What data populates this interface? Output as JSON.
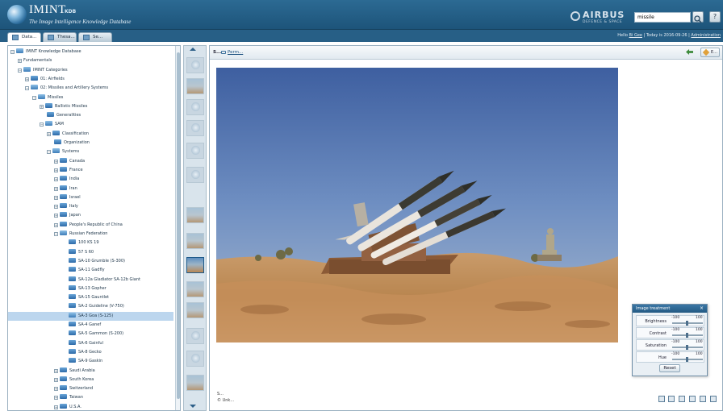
{
  "header": {
    "app_name": "IMINT",
    "app_name_suffix": "KDB",
    "subtitle": "The Image Intelligence Knowledge Database",
    "brand_name": "AIRBUS",
    "brand_sub": "DEFENCE & SPACE",
    "search_value": "missile",
    "help_label": "?"
  },
  "tabs": [
    {
      "label": "Data..."
    },
    {
      "label": "Thesa..."
    },
    {
      "label": "Se..."
    }
  ],
  "user_info": {
    "prefix": "Hello",
    "user": "Bi Gee",
    "today": "| Today is 2016-09-26 |",
    "admin": "Administration"
  },
  "tree": [
    {
      "label": "IMINT Knowledge Database",
      "level": 0,
      "expander": "−",
      "folder": "open"
    },
    {
      "label": "Fundamentals",
      "level": 1,
      "expander": "+",
      "folder": "none"
    },
    {
      "label": "IMINT Categories",
      "level": 1,
      "expander": "−",
      "folder": "open"
    },
    {
      "label": "01: Airfields",
      "level": 2,
      "expander": "+",
      "folder": "closed"
    },
    {
      "label": "02: Missiles and Artillery Systems",
      "level": 2,
      "expander": "−",
      "folder": "open"
    },
    {
      "label": "Missiles",
      "level": 3,
      "expander": "−",
      "folder": "open"
    },
    {
      "label": "Ballistic Missiles",
      "level": 4,
      "expander": "+",
      "folder": "closed"
    },
    {
      "label": "Generalities",
      "level": 4,
      "expander": "",
      "folder": "closed"
    },
    {
      "label": "SAM",
      "level": 4,
      "expander": "−",
      "folder": "open"
    },
    {
      "label": "Classification",
      "level": 5,
      "expander": "+",
      "folder": "closed"
    },
    {
      "label": "Organization",
      "level": 5,
      "expander": "",
      "folder": "closed"
    },
    {
      "label": "Systems",
      "level": 5,
      "expander": "−",
      "folder": "open"
    },
    {
      "label": "Canada",
      "level": 6,
      "expander": "+",
      "folder": "closed"
    },
    {
      "label": "France",
      "level": 6,
      "expander": "+",
      "folder": "closed"
    },
    {
      "label": "India",
      "level": 6,
      "expander": "+",
      "folder": "closed"
    },
    {
      "label": "Iran",
      "level": 6,
      "expander": "+",
      "folder": "closed"
    },
    {
      "label": "Israel",
      "level": 6,
      "expander": "+",
      "folder": "closed"
    },
    {
      "label": "Italy",
      "level": 6,
      "expander": "+",
      "folder": "closed"
    },
    {
      "label": "Japan",
      "level": 6,
      "expander": "+",
      "folder": "closed"
    },
    {
      "label": "People's Republic of China",
      "level": 6,
      "expander": "+",
      "folder": "closed"
    },
    {
      "label": "Russian Federation",
      "level": 6,
      "expander": "−",
      "folder": "open"
    },
    {
      "label": "100 KS 19",
      "level": 7,
      "expander": "",
      "folder": "closed"
    },
    {
      "label": "57 S 60",
      "level": 7,
      "expander": "",
      "folder": "closed"
    },
    {
      "label": "SA-10 Grumble (S-300)",
      "level": 7,
      "expander": "",
      "folder": "closed"
    },
    {
      "label": "SA-11 Gadfly",
      "level": 7,
      "expander": "",
      "folder": "closed"
    },
    {
      "label": "SA-12a Gladiator SA-12b Giant",
      "level": 7,
      "expander": "",
      "folder": "closed"
    },
    {
      "label": "SA-13 Gopher",
      "level": 7,
      "expander": "",
      "folder": "closed"
    },
    {
      "label": "SA-15 Gauntlet",
      "level": 7,
      "expander": "",
      "folder": "closed"
    },
    {
      "label": "SA-2 Guideline (V-750)",
      "level": 7,
      "expander": "",
      "folder": "closed"
    },
    {
      "label": "SA-3 Goa (S-125)",
      "level": 7,
      "expander": "",
      "folder": "open",
      "selected": true
    },
    {
      "label": "SA-4 Ganef",
      "level": 7,
      "expander": "",
      "folder": "closed"
    },
    {
      "label": "SA-5 Gammon (S-200)",
      "level": 7,
      "expander": "",
      "folder": "closed"
    },
    {
      "label": "SA-6 Gainful",
      "level": 7,
      "expander": "",
      "folder": "closed"
    },
    {
      "label": "SA-8 Gecko",
      "level": 7,
      "expander": "",
      "folder": "closed"
    },
    {
      "label": "SA-9 Gaskin",
      "level": 7,
      "expander": "",
      "folder": "closed"
    },
    {
      "label": "Saudi Arabia",
      "level": 6,
      "expander": "+",
      "folder": "closed"
    },
    {
      "label": "South Korea",
      "level": 6,
      "expander": "+",
      "folder": "closed"
    },
    {
      "label": "Switzerland",
      "level": 6,
      "expander": "+",
      "folder": "closed"
    },
    {
      "label": "Taiwan",
      "level": 6,
      "expander": "+",
      "folder": "closed"
    },
    {
      "label": "U.S.A.",
      "level": 6,
      "expander": "+",
      "folder": "closed"
    }
  ],
  "viewer": {
    "toolbar_s": "S...",
    "perm_label": "Perm...",
    "edit_label": "E...",
    "footer_line1": "S...",
    "footer_line2": "© Unk..."
  },
  "treatment": {
    "title": "Image treatment",
    "close": "×",
    "rows": [
      {
        "label": "Brightness",
        "min": "-100",
        "max": "100"
      },
      {
        "label": "Contrast",
        "min": "-100",
        "max": "100"
      },
      {
        "label": "Saturation",
        "min": "-100",
        "max": "100"
      },
      {
        "label": "Hue",
        "min": "-100",
        "max": "100"
      }
    ],
    "reset_label": "Reset"
  },
  "colors": {
    "header": "#245d86",
    "selection": "#bcd6ee",
    "folder": "#2d6aa8"
  }
}
